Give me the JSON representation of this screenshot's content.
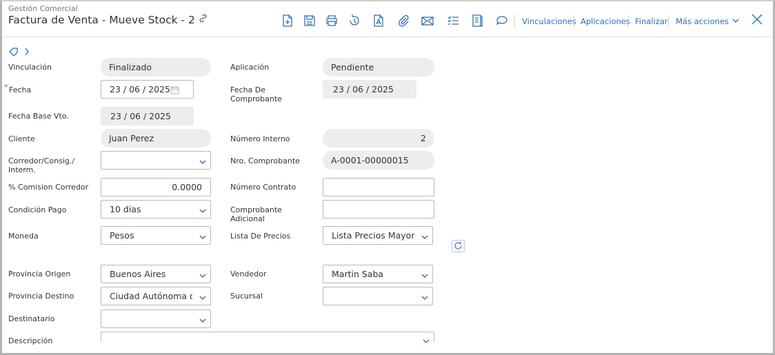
{
  "header": {
    "module": "Gestión Comercial",
    "title": "Factura de Venta - Mueve Stock - 2",
    "links": {
      "vinculaciones": "Vinculaciones",
      "aplicaciones": "Aplicaciones",
      "finalizar": "Finalizar",
      "mas_acciones": "Más acciones"
    },
    "accent_color": "#2c6fb5"
  },
  "form": {
    "vinculacion": {
      "label": "Vinculación",
      "value": "Finalizado"
    },
    "aplicacion": {
      "label": "Aplicación",
      "value": "Pendiente"
    },
    "fecha": {
      "label": "Fecha",
      "required_mark": "*",
      "value": "23 / 06 / 2025"
    },
    "fecha_comprobante": {
      "label_line1": "Fecha De",
      "label_line2": "Comprobante",
      "value": "23 / 06 / 2025"
    },
    "fecha_base_vto": {
      "label": "Fecha Base Vto.",
      "value": "23 / 06 / 2025"
    },
    "cliente": {
      "label": "Cliente",
      "value": "Juan Perez"
    },
    "numero_interno": {
      "label": "Número Interno",
      "value": "2"
    },
    "corredor": {
      "label_line1": "Corredor/Consig./",
      "label_line2": "Interm.",
      "value": ""
    },
    "nro_comprobante": {
      "label": "Nro. Comprobante",
      "value": "A-0001-00000015"
    },
    "comision_corredor": {
      "label": "% Comision Corredor",
      "value": "0.0000"
    },
    "numero_contrato": {
      "label": "Número Contrato",
      "value": ""
    },
    "condicion_pago": {
      "label": "Condición Pago",
      "value": "10 dias"
    },
    "comprobante_adicional": {
      "label_line1": "Comprobante",
      "label_line2": "Adicional",
      "value": ""
    },
    "moneda": {
      "label": "Moneda",
      "value": "Pesos"
    },
    "lista_precios": {
      "label": "Lista De Precios",
      "value": "Lista Precios Mayorista"
    },
    "provincia_origen": {
      "label": "Provincia Origen",
      "value": "Buenos Aires"
    },
    "vendedor": {
      "label": "Vendedor",
      "value": "Martin Saba"
    },
    "provincia_destino": {
      "label": "Provincia Destino",
      "value": "Ciudad Autónoma de Buenos Aires"
    },
    "sucursal": {
      "label": "Sucursal",
      "value": ""
    },
    "destinatario": {
      "label": "Destinatario",
      "value": ""
    },
    "descripcion": {
      "label": "Descripción",
      "value": ""
    }
  }
}
